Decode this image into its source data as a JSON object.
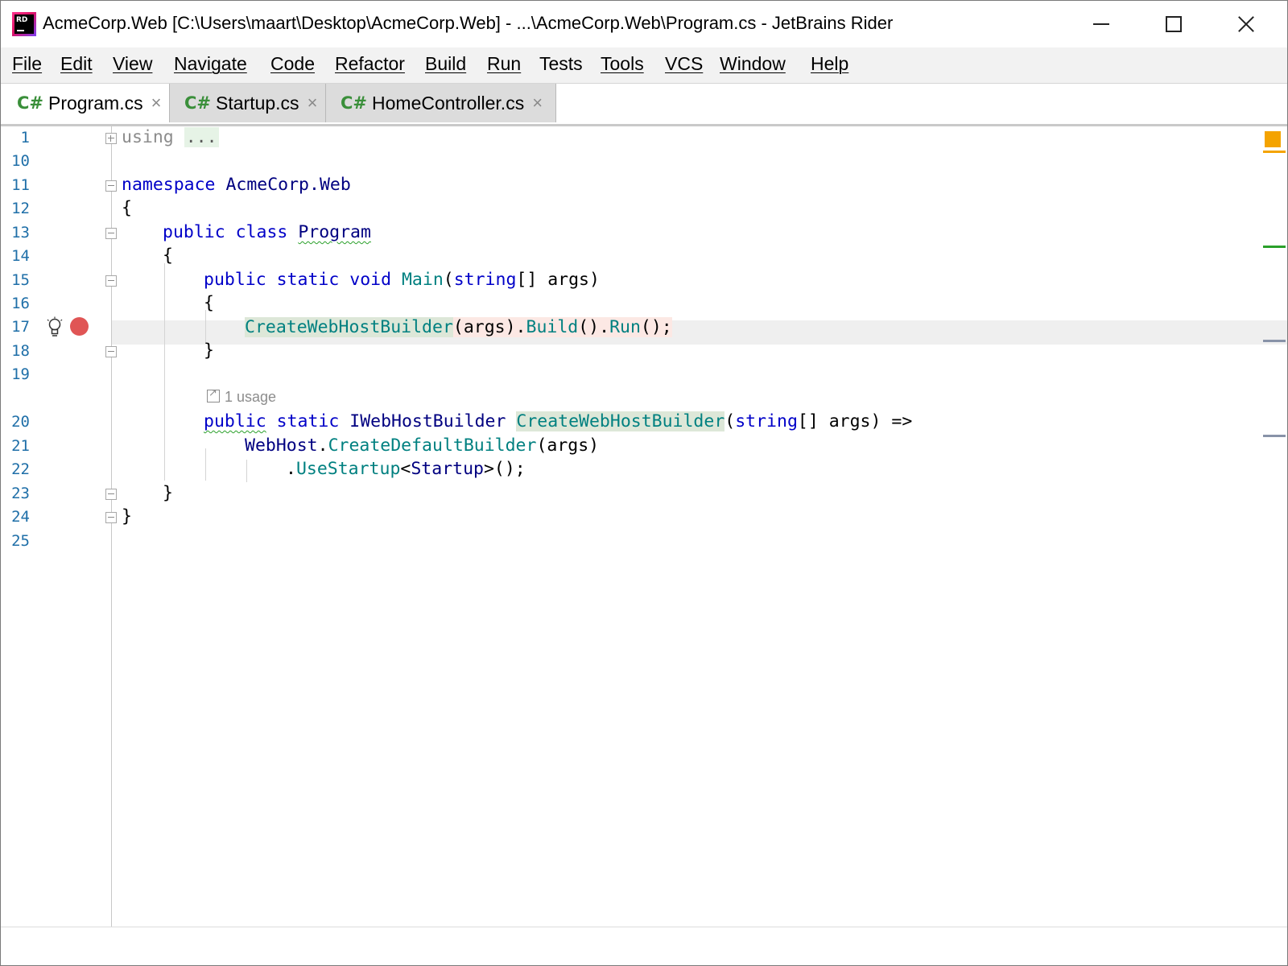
{
  "window": {
    "title": "AcmeCorp.Web [C:\\Users\\maart\\Desktop\\AcmeCorp.Web] - ...\\AcmeCorp.Web\\Program.cs - JetBrains Rider",
    "app_logo_text": "RD",
    "app_icon": "rider-logo-icon"
  },
  "menu": [
    "File",
    "Edit",
    "View",
    "Navigate",
    "Code",
    "Refactor",
    "Build",
    "Run",
    "Tests",
    "Tools",
    "VCS",
    "Window",
    "Help"
  ],
  "tabs": [
    {
      "icon_label": "C#",
      "label": "Program.cs",
      "active": true
    },
    {
      "icon_label": "C#",
      "label": "Startup.cs",
      "active": false
    },
    {
      "icon_label": "C#",
      "label": "HomeController.cs",
      "active": false
    }
  ],
  "tab_close_glyph": "×",
  "editor": {
    "line_numbers": [
      "1",
      "10",
      "11",
      "12",
      "13",
      "14",
      "15",
      "16",
      "17",
      "18",
      "19",
      "20",
      "21",
      "22",
      "23",
      "24",
      "25"
    ],
    "usage_hint": "1 usage",
    "current_line": "17",
    "breakpoint_line": "17",
    "code": {
      "l1_using": "using",
      "l1_dots": "...",
      "l11_kw": "namespace",
      "l11_name": "AcmeCorp.Web",
      "open_brace": "{",
      "close_brace": "}",
      "kw_public": "public",
      "kw_class": "class",
      "kw_static": "static",
      "kw_void": "void",
      "kw_string": "string",
      "class_name": "Program",
      "main_name": "Main",
      "args_part": "[] args)",
      "open_paren": "(",
      "args_arrow": "[] args) =>",
      "create_builder": "CreateWebHostBuilder",
      "args_call": "(args).",
      "build": "Build",
      "call_dot": "().",
      "run": "Run",
      "end_call": "();",
      "iwebhost": "IWebHostBuilder",
      "webhost": "WebHost",
      "dot": ".",
      "create_default": "CreateDefaultBuilder",
      "args_close": "(args)",
      "use_startup": "UseStartup",
      "lt": "<",
      "startup": "Startup",
      "gt_end": ">();"
    }
  },
  "colors": {
    "keyword": "#0000c8",
    "method": "#008080",
    "line_number": "#1f6fa8",
    "breakpoint": "#e05555",
    "warning_stripe": "#f4a300"
  }
}
